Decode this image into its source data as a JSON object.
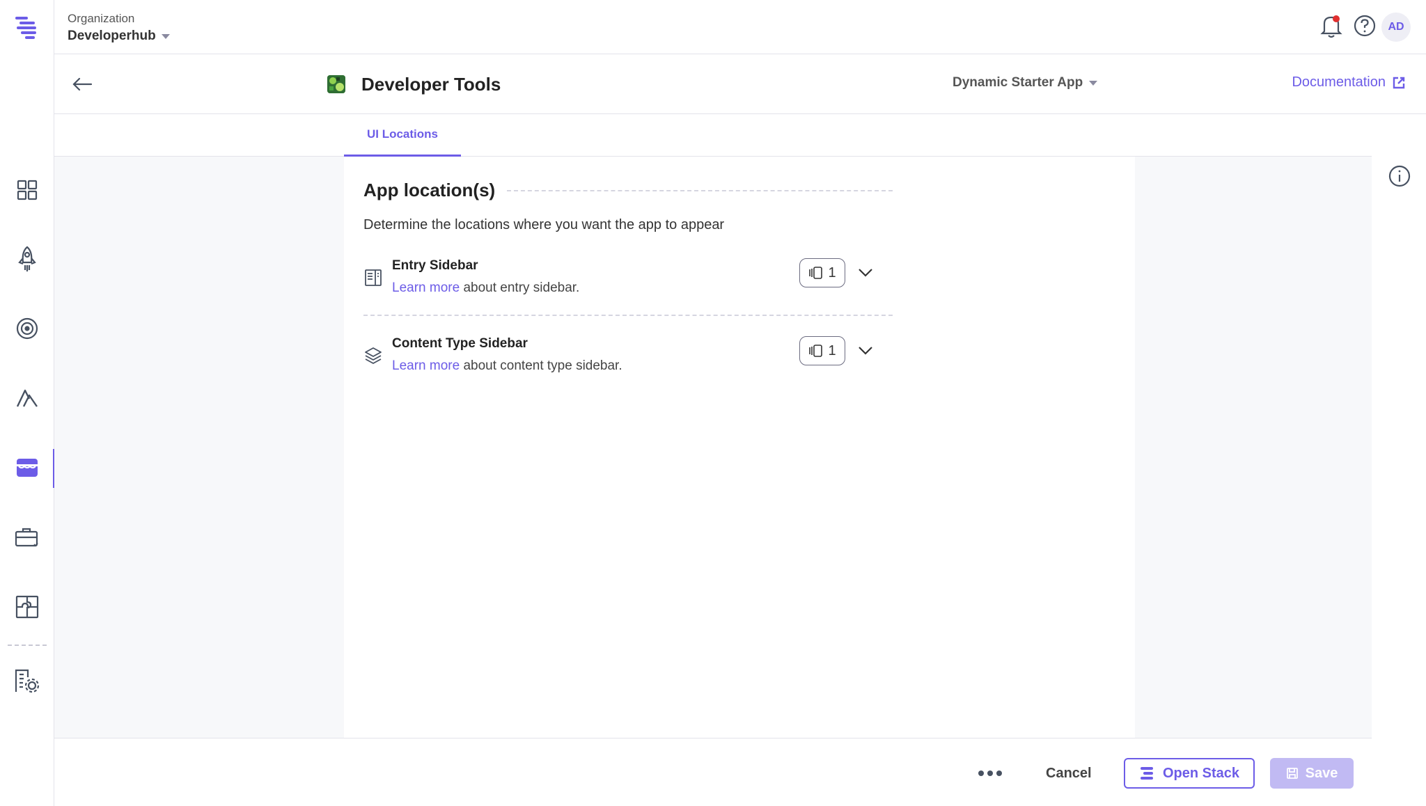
{
  "topbar": {
    "org_label": "Organization",
    "org_name": "Developerhub",
    "avatar_initials": "AD",
    "notification_dot_color": "#e02f2f"
  },
  "rail": {
    "items": [
      {
        "icon": "dashboard-grid-icon"
      },
      {
        "icon": "rocket-icon"
      },
      {
        "icon": "target-icon"
      },
      {
        "icon": "automation-icon"
      },
      {
        "icon": "marketplace-store-icon",
        "active": true
      },
      {
        "icon": "toolbox-icon"
      },
      {
        "icon": "puzzle-icon"
      },
      {
        "icon": "organization-settings-icon"
      }
    ]
  },
  "header": {
    "app_title": "Developer Tools",
    "app_switcher": "Dynamic Starter App",
    "documentation_label": "Documentation"
  },
  "tabs": [
    {
      "label": "UI Locations",
      "active": true
    }
  ],
  "section": {
    "title": "App location(s)",
    "description": "Determine the locations where you want the app to appear"
  },
  "locations": [
    {
      "name": "Entry Sidebar",
      "link_text": "Learn more",
      "desc_suffix": " about entry sidebar.",
      "count": "1",
      "icon": "entry-sidebar-icon"
    },
    {
      "name": "Content Type Sidebar",
      "link_text": "Learn more",
      "desc_suffix": " about content type sidebar.",
      "count": "1",
      "icon": "layers-icon"
    }
  ],
  "footer": {
    "cancel_label": "Cancel",
    "open_stack_label": "Open Stack",
    "save_label": "Save"
  },
  "colors": {
    "accent": "#6c5ce7",
    "save_disabled": "#c1baf3"
  }
}
